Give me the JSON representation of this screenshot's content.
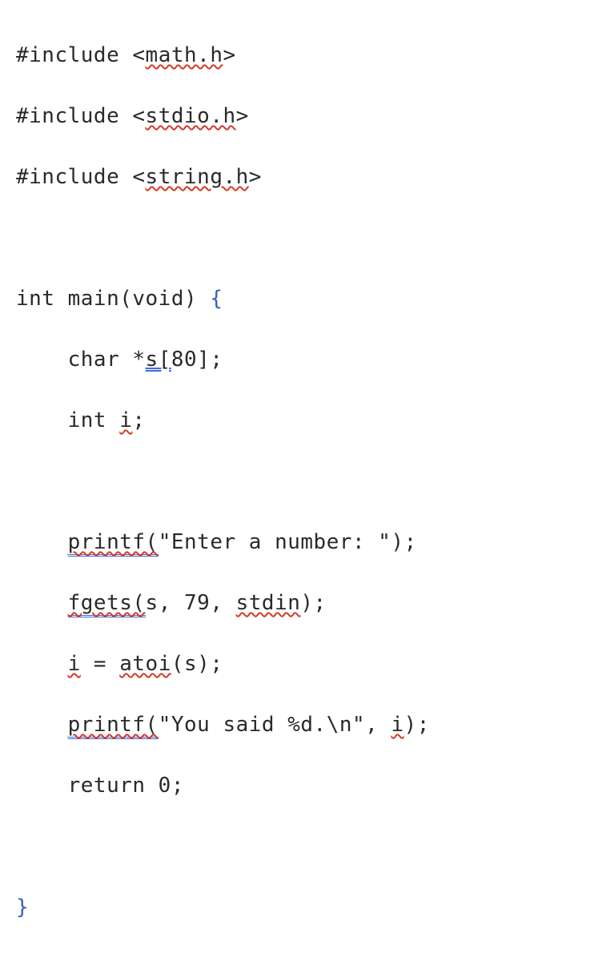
{
  "code": {
    "l1_a": "#include <",
    "l1_b": "math.h",
    "l1_c": ">",
    "l2_a": "#include <",
    "l2_b": "stdio.h",
    "l2_c": ">",
    "l3_a": "#include <",
    "l3_b": "string.h",
    "l3_c": ">",
    "l5_a": "int main(void) ",
    "l5_b": "{",
    "l6_a": "    char *",
    "l6_b": "s[",
    "l6_c": "80];",
    "l7_a": "    int ",
    "l7_b": "i",
    "l7_c": ";",
    "l9_a": "    ",
    "l9_b": "printf(",
    "l9_c": "\"Enter a number: \");",
    "l10_a": "    ",
    "l10_b": "fgets(",
    "l10_c": "s, 79, ",
    "l10_d": "stdin",
    "l10_e": ");",
    "l11_a": "    ",
    "l11_b": "i",
    "l11_c": " = ",
    "l11_d": "atoi",
    "l11_e": "(s);",
    "l12_a": "    ",
    "l12_b": "printf(",
    "l12_c": "\"You said %d.\\n\", ",
    "l12_d": "i",
    "l12_e": ");",
    "l13_a": "    return 0;",
    "l15_a": "}"
  }
}
